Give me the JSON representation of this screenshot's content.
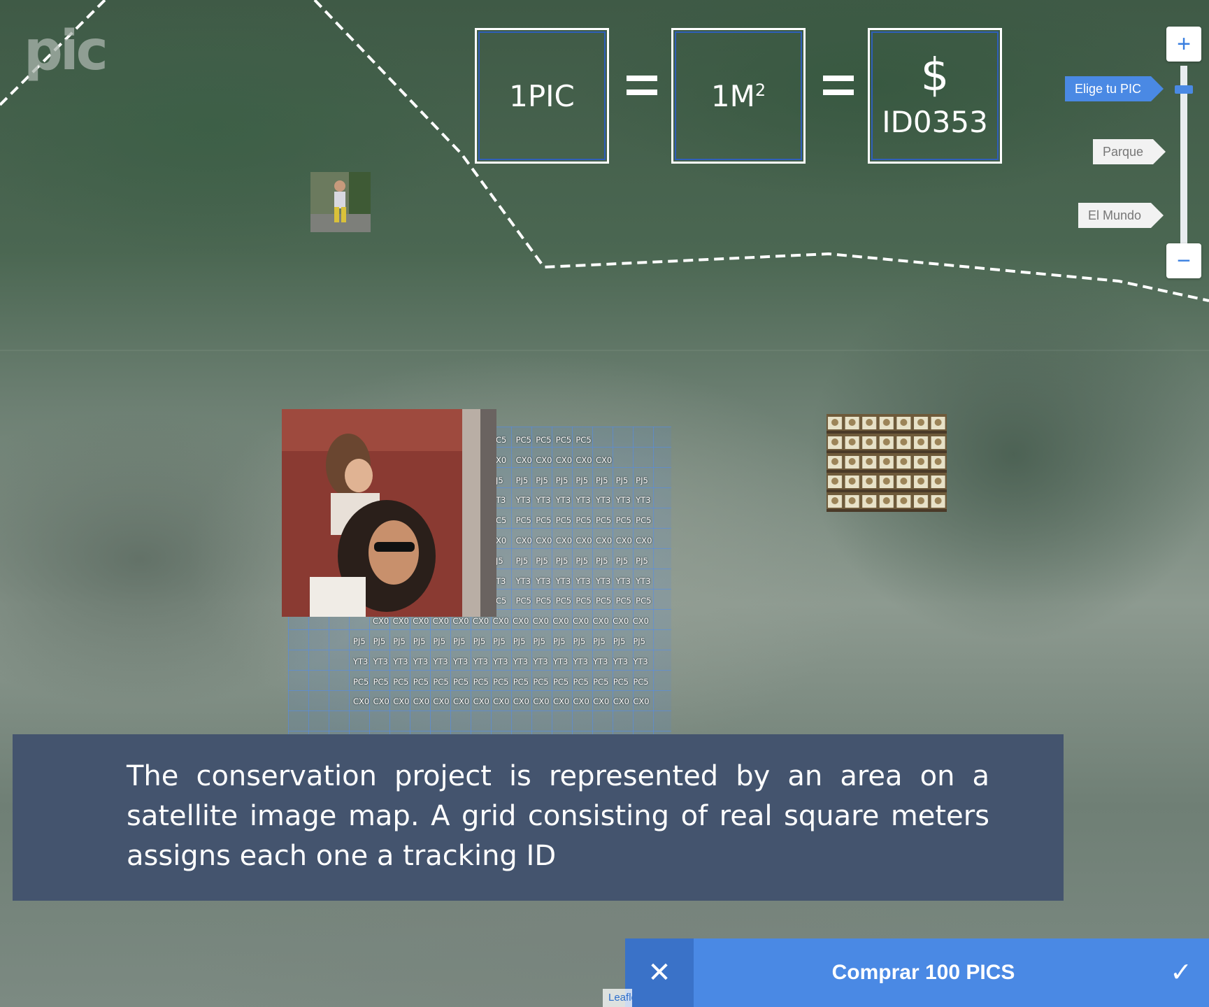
{
  "logo": {
    "text": "pic"
  },
  "equation": {
    "box1": "1PIC",
    "box2_base": "1M",
    "box2_sup": "2",
    "box3_symbol": "$",
    "box3_id": "ID0353"
  },
  "zoom": {
    "zoom_in": "+",
    "zoom_out": "−",
    "levels": [
      {
        "label": "Elige tu PIC",
        "active": true
      },
      {
        "label": "Parque",
        "active": false
      },
      {
        "label": "El Mundo",
        "active": false
      }
    ]
  },
  "grid": {
    "codes": [
      "PC5",
      "CX0",
      "PJ5",
      "YT3"
    ],
    "rows": [
      {
        "cells": [
          "C5",
          "PC5",
          "PC5",
          "PC5",
          "PC5"
        ]
      },
      {
        "cells": [
          "X0",
          "CX0",
          "CX0",
          "CX0",
          "CX0",
          "CX0"
        ]
      },
      {
        "cells": [
          "J5",
          "PJ5",
          "PJ5",
          "PJ5",
          "PJ5",
          "PJ5",
          "PJ5",
          "PJ5"
        ]
      },
      {
        "cells": [
          "T3",
          "YT3",
          "YT3",
          "YT3",
          "YT3",
          "YT3",
          "YT3",
          "YT3"
        ]
      },
      {
        "cells": [
          "C5",
          "PC5",
          "PC5",
          "PC5",
          "PC5",
          "PC5",
          "PC5",
          "PC5"
        ]
      },
      {
        "cells": [
          "X0",
          "CX0",
          "CX0",
          "CX0",
          "CX0",
          "CX0",
          "CX0",
          "CX0"
        ]
      },
      {
        "cells": [
          "J5",
          "PJ5",
          "PJ5",
          "PJ5",
          "PJ5",
          "PJ5",
          "PJ5",
          "PJ5"
        ]
      },
      {
        "cells": [
          "T3",
          "YT3",
          "YT3",
          "YT3",
          "YT3",
          "YT3",
          "YT3",
          "YT3"
        ]
      },
      {
        "cells": [
          "C5",
          "PC5",
          "PC5",
          "PC5",
          "PC5",
          "PC5",
          "PC5",
          "PC5"
        ]
      },
      {
        "cells": [
          "CX0",
          "CX0",
          "CX0",
          "CX0",
          "CX0",
          "CX0",
          "CX0",
          "CX0",
          "CX0",
          "CX0",
          "CX0",
          "CX0",
          "CX0",
          "CX0"
        ]
      },
      {
        "cells": [
          "PJ5",
          "PJ5",
          "PJ5",
          "PJ5",
          "PJ5",
          "PJ5",
          "PJ5",
          "PJ5",
          "PJ5",
          "PJ5",
          "PJ5",
          "PJ5",
          "PJ5",
          "PJ5",
          "PJ5"
        ]
      },
      {
        "cells": [
          "YT3",
          "YT3",
          "YT3",
          "YT3",
          "YT3",
          "YT3",
          "YT3",
          "YT3",
          "YT3",
          "YT3",
          "YT3",
          "YT3",
          "YT3",
          "YT3",
          "YT3"
        ]
      },
      {
        "cells": [
          "PC5",
          "PC5",
          "PC5",
          "PC5",
          "PC5",
          "PC5",
          "PC5",
          "PC5",
          "PC5",
          "PC5",
          "PC5",
          "PC5",
          "PC5",
          "PC5",
          "PC5"
        ]
      },
      {
        "cells": [
          "CX0",
          "CX0",
          "CX0",
          "CX0",
          "CX0",
          "CX0",
          "CX0",
          "CX0",
          "CX0",
          "CX0",
          "CX0",
          "CX0",
          "CX0",
          "CX0",
          "CX0"
        ]
      }
    ]
  },
  "caption": {
    "text": "The conservation project is represented by an area on a satellite image map. A grid consisting of real square meters assigns each one a tracking ID"
  },
  "buy_bar": {
    "label": "Comprar 100 PICS",
    "cancel_icon": "close-icon",
    "confirm_icon": "check-icon"
  },
  "attribution": {
    "text": "Leaflet"
  },
  "colors": {
    "accent": "#4a89e4",
    "caption_bg": "#44546e",
    "box_outline": "#2f5fb8"
  }
}
